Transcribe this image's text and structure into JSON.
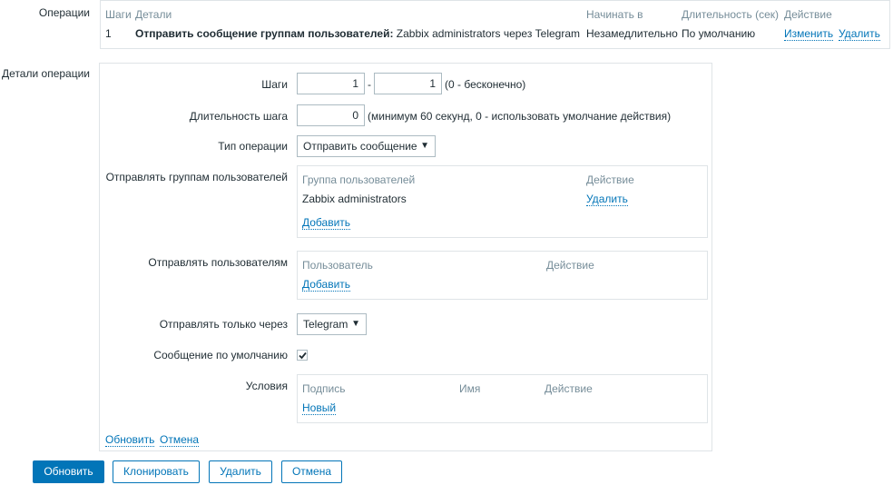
{
  "operations": {
    "label": "Операции",
    "headers": {
      "steps": "Шаги",
      "details": "Детали",
      "start_in": "Начинать в",
      "duration": "Длительность (сек)",
      "action": "Действие"
    },
    "row": {
      "steps": "1",
      "details_bold": "Отправить сообщение группам пользователей:",
      "details_rest": "Zabbix administrators через Telegram",
      "start_in": "Незамедлительно",
      "duration": "По умолчанию",
      "edit": "Изменить",
      "remove": "Удалить"
    }
  },
  "details": {
    "label": "Детали операции",
    "steps": {
      "label": "Шаги",
      "from": "1",
      "dash": "-",
      "to": "1",
      "hint": "(0 - бесконечно)"
    },
    "step_duration": {
      "label": "Длительность шага",
      "value": "0",
      "hint": "(минимум 60 секунд, 0 - использовать умолчание действия)"
    },
    "operation_type": {
      "label": "Тип операции",
      "value": "Отправить сообщение"
    },
    "send_to_groups": {
      "label": "Отправлять группам пользователей",
      "col_group": "Группа пользователей",
      "col_action": "Действие",
      "rows": [
        {
          "name": "Zabbix administrators",
          "action": "Удалить"
        }
      ],
      "add": "Добавить"
    },
    "send_to_users": {
      "label": "Отправлять пользователям",
      "col_user": "Пользователь",
      "col_action": "Действие",
      "add": "Добавить"
    },
    "send_only_to": {
      "label": "Отправлять только через",
      "value": "Telegram"
    },
    "default_message": {
      "label": "Сообщение по умолчанию",
      "checked": true
    },
    "conditions": {
      "label": "Условия",
      "col_label": "Подпись",
      "col_name": "Имя",
      "col_action": "Действие",
      "new": "Новый"
    },
    "update_link": "Обновить",
    "cancel_link": "Отмена"
  },
  "buttons": {
    "update": "Обновить",
    "clone": "Клонировать",
    "delete": "Удалить",
    "cancel": "Отмена"
  },
  "colors": {
    "link": "#0275b8",
    "muted": "#768d99",
    "border": "#dfe4e7",
    "primary": "#0275b8"
  }
}
